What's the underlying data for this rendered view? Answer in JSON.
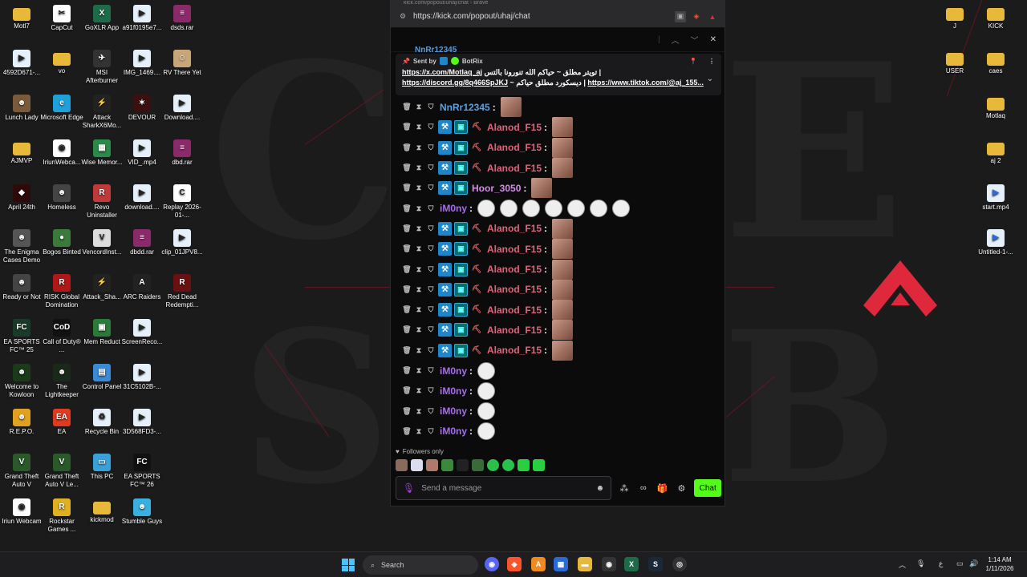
{
  "colors": {
    "kick_green": "#53fc18",
    "mod_badge": "#1f86c9",
    "alanod_name": "#e0637a",
    "nnrr_name": "#5aa0e6",
    "hoor_name": "#d58be8",
    "im0ny_name": "#a86cf0",
    "apex_red": "#e0283c"
  },
  "desktop_left": [
    {
      "label": "Motl7",
      "icon": "folder-icon",
      "color": "#e8b83a",
      "glyph": ""
    },
    {
      "label": "CapCut",
      "icon": "capcut-icon",
      "color": "#ffffff",
      "glyph": "✂"
    },
    {
      "label": "GoXLR App",
      "icon": "goxlr-icon",
      "color": "#1e6b4a",
      "glyph": "X"
    },
    {
      "label": "a91f0195e7...",
      "icon": "file-icon",
      "color": "#e6f0fa",
      "glyph": "▶"
    },
    {
      "label": "dsds.rar",
      "icon": "rar-icon",
      "color": "#8a2a6a",
      "glyph": "≡"
    },
    {
      "label": "4592D671-...",
      "icon": "file-icon",
      "color": "#e6f0fa",
      "glyph": "▶"
    },
    {
      "label": "vo",
      "icon": "folder-icon",
      "color": "#e8b83a",
      "glyph": ""
    },
    {
      "label": "MSI Afterburner",
      "icon": "msi-icon",
      "color": "#333333",
      "glyph": "✈"
    },
    {
      "label": "IMG_1469....",
      "icon": "file-icon",
      "color": "#e6f0fa",
      "glyph": "▶"
    },
    {
      "label": "RV There Yet",
      "icon": "game-icon",
      "color": "#c8a67a",
      "glyph": "☺"
    },
    {
      "label": "Lunch Lady",
      "icon": "game-icon",
      "color": "#7a5a3a",
      "glyph": "☻"
    },
    {
      "label": "Microsoft Edge",
      "icon": "edge-icon",
      "color": "#1fa0d8",
      "glyph": "e"
    },
    {
      "label": "Attack SharkX6Mo...",
      "icon": "mouse-icon",
      "color": "#222222",
      "glyph": "⚡"
    },
    {
      "label": "DEVOUR",
      "icon": "game-icon",
      "color": "#3a1010",
      "glyph": "✶"
    },
    {
      "label": "Download....",
      "icon": "file-icon",
      "color": "#e6f0fa",
      "glyph": "▶"
    },
    {
      "label": "AJMVP",
      "icon": "folder-icon",
      "color": "#e8b83a",
      "glyph": ""
    },
    {
      "label": "IriunWebca...",
      "icon": "webcam-icon",
      "color": "#ffffff",
      "glyph": "◉"
    },
    {
      "label": "Wise Memor...",
      "icon": "app-icon",
      "color": "#2a8a4a",
      "glyph": "▦"
    },
    {
      "label": "VID_.mp4",
      "icon": "file-icon",
      "color": "#e6f0fa",
      "glyph": "▶"
    },
    {
      "label": "dbd.rar",
      "icon": "rar-icon",
      "color": "#8a2a6a",
      "glyph": "≡"
    },
    {
      "label": "April 24th",
      "icon": "game-icon",
      "color": "#300a0a",
      "glyph": "◆"
    },
    {
      "label": "Homeless",
      "icon": "game-icon",
      "color": "#444444",
      "glyph": "☻"
    },
    {
      "label": "Revo Uninstaller",
      "icon": "app-icon",
      "color": "#c03a3a",
      "glyph": "R"
    },
    {
      "label": "download....",
      "icon": "file-icon",
      "color": "#e6f0fa",
      "glyph": "▶"
    },
    {
      "label": "Replay 2026-01-...",
      "icon": "capcut-icon",
      "color": "#ffffff",
      "glyph": "C"
    },
    {
      "label": "The Enigma Cases Demo",
      "icon": "game-icon",
      "color": "#555555",
      "glyph": "☻"
    },
    {
      "label": "Bogos Binted",
      "icon": "game-icon",
      "color": "#3a7a3a",
      "glyph": "●"
    },
    {
      "label": "VencordInst...",
      "icon": "app-icon",
      "color": "#dddddd",
      "glyph": "V"
    },
    {
      "label": "dbdd.rar",
      "icon": "rar-icon",
      "color": "#8a2a6a",
      "glyph": "≡"
    },
    {
      "label": "clip_01JPV8...",
      "icon": "file-icon",
      "color": "#e6f0fa",
      "glyph": "▶"
    },
    {
      "label": "Ready or Not",
      "icon": "game-icon",
      "color": "#444444",
      "glyph": "☻"
    },
    {
      "label": "RISK Global Domination",
      "icon": "game-icon",
      "color": "#b01818",
      "glyph": "R"
    },
    {
      "label": "Attack_Sha...",
      "icon": "mouse-icon",
      "color": "#222222",
      "glyph": "⚡"
    },
    {
      "label": "ARC Raiders",
      "icon": "game-icon",
      "color": "#222222",
      "glyph": "A"
    },
    {
      "label": "Red Dead Redempti...",
      "icon": "game-icon",
      "color": "#6a1010",
      "glyph": "R"
    },
    {
      "label": "EA SPORTS FC™ 25",
      "icon": "game-icon",
      "color": "#1a3a2a",
      "glyph": "FC"
    },
    {
      "label": "Call of Duty® ...",
      "icon": "game-icon",
      "color": "#111111",
      "glyph": "CoD"
    },
    {
      "label": "Mem Reduct",
      "icon": "app-icon",
      "color": "#2a7a3a",
      "glyph": "▣"
    },
    {
      "label": "ScreenReco...",
      "icon": "file-icon",
      "color": "#e6f0fa",
      "glyph": "▶"
    },
    {
      "label": "",
      "icon": "blank",
      "color": "transparent",
      "glyph": ""
    },
    {
      "label": "Welcome to Kowloon",
      "icon": "game-icon",
      "color": "#1a3a1a",
      "glyph": "☻"
    },
    {
      "label": "The Lightkeeper",
      "icon": "game-icon",
      "color": "#1a2a1a",
      "glyph": "☻"
    },
    {
      "label": "Control Panel",
      "icon": "control-panel-icon",
      "color": "#3a8ad8",
      "glyph": "▤"
    },
    {
      "label": "31C5102B-...",
      "icon": "file-icon",
      "color": "#e6f0fa",
      "glyph": "▶"
    },
    {
      "label": "",
      "icon": "blank",
      "color": "transparent",
      "glyph": ""
    },
    {
      "label": "R.E.P.O.",
      "icon": "game-icon",
      "color": "#e0a020",
      "glyph": "☻"
    },
    {
      "label": "EA",
      "icon": "ea-icon",
      "color": "#e03a20",
      "glyph": "EA"
    },
    {
      "label": "Recycle Bin",
      "icon": "recycle-bin-icon",
      "color": "#e6f0fa",
      "glyph": "♻"
    },
    {
      "label": "3D568FD3-...",
      "icon": "file-icon",
      "color": "#e6f0fa",
      "glyph": "▶"
    },
    {
      "label": "",
      "icon": "blank",
      "color": "transparent",
      "glyph": ""
    },
    {
      "label": "Grand Theft Auto V",
      "icon": "game-icon",
      "color": "#2a5a2a",
      "glyph": "V"
    },
    {
      "label": "Grand Theft Auto V Le...",
      "icon": "game-icon",
      "color": "#2a5a2a",
      "glyph": "V"
    },
    {
      "label": "This PC",
      "icon": "this-pc-icon",
      "color": "#3aa0d8",
      "glyph": "▭"
    },
    {
      "label": "EA SPORTS FC™ 26",
      "icon": "game-icon",
      "color": "#111111",
      "glyph": "FC"
    },
    {
      "label": "",
      "icon": "blank",
      "color": "transparent",
      "glyph": ""
    },
    {
      "label": "Iriun Webcam",
      "icon": "webcam-icon",
      "color": "#ffffff",
      "glyph": "◉"
    },
    {
      "label": "Rockstar Games ...",
      "icon": "game-icon",
      "color": "#e0b020",
      "glyph": "R"
    },
    {
      "label": "kickmod",
      "icon": "folder-icon",
      "color": "#e8b83a",
      "glyph": ""
    },
    {
      "label": "Stumble Guys",
      "icon": "game-icon",
      "color": "#3ab0e0",
      "glyph": "☻"
    }
  ],
  "desktop_right": [
    {
      "label": "J",
      "icon": "folder-icon"
    },
    {
      "label": "KICK",
      "icon": "folder-icon"
    },
    {
      "label": "USER",
      "icon": "folder-icon"
    },
    {
      "label": "caes",
      "icon": "folder-icon"
    },
    {
      "label": "Motlaq",
      "icon": "folder-icon"
    },
    {
      "label": "aj 2",
      "icon": "folder-icon"
    },
    {
      "label": "start.mp4",
      "icon": "file-icon"
    },
    {
      "label": "Untitled-1-...",
      "icon": "file-icon"
    }
  ],
  "browser": {
    "title": "kick.com/popout/uhaj/chat - Brave",
    "url": "https://kick.com/popout/uhaj/chat",
    "cut_message": "NnRr12345"
  },
  "pinned": {
    "sent_by_prefix": "Sent by",
    "sender": "BotRix",
    "line1_link": "https://x.com/Motlaq_aj",
    "line1_text": "تويتر مطلق ~ حياكم الله تنورونا بالتس |",
    "line2_link": "https://discord.gg/8q466SpJKJ",
    "line2_text": "~ ديسكورد مطلق حياكم |",
    "line2_link2": "https://www.tiktok.com/@aj_155..."
  },
  "messages": [
    {
      "user": "NnRr12345",
      "color": "#5aa0e6",
      "badges": [],
      "emote": "img"
    },
    {
      "user": "Alanod_F15",
      "color": "#e0637a",
      "badges": [
        "mod",
        "sub",
        "pick"
      ],
      "emote": "img"
    },
    {
      "user": "Alanod_F15",
      "color": "#e0637a",
      "badges": [
        "mod",
        "sub",
        "pick"
      ],
      "emote": "img"
    },
    {
      "user": "Alanod_F15",
      "color": "#e0637a",
      "badges": [
        "mod",
        "sub",
        "pick"
      ],
      "emote": "img"
    },
    {
      "user": "Hoor_3050",
      "color": "#d58be8",
      "badges": [
        "mod",
        "sub"
      ],
      "emote": "img"
    },
    {
      "user": "iM0ny",
      "color": "#a86cf0",
      "badges": [],
      "emote": "round7"
    },
    {
      "user": "Alanod_F15",
      "color": "#e0637a",
      "badges": [
        "mod",
        "sub",
        "pick"
      ],
      "emote": "img"
    },
    {
      "user": "Alanod_F15",
      "color": "#e0637a",
      "badges": [
        "mod",
        "sub",
        "pick"
      ],
      "emote": "img"
    },
    {
      "user": "Alanod_F15",
      "color": "#e0637a",
      "badges": [
        "mod",
        "sub",
        "pick"
      ],
      "emote": "img"
    },
    {
      "user": "Alanod_F15",
      "color": "#e0637a",
      "badges": [
        "mod",
        "sub",
        "pick"
      ],
      "emote": "img"
    },
    {
      "user": "Alanod_F15",
      "color": "#e0637a",
      "badges": [
        "mod",
        "sub",
        "pick"
      ],
      "emote": "img"
    },
    {
      "user": "Alanod_F15",
      "color": "#e0637a",
      "badges": [
        "mod",
        "sub",
        "pick"
      ],
      "emote": "img"
    },
    {
      "user": "Alanod_F15",
      "color": "#e0637a",
      "badges": [
        "mod",
        "sub",
        "pick"
      ],
      "emote": "img"
    },
    {
      "user": "iM0ny",
      "color": "#a86cf0",
      "badges": [],
      "emote": "round1"
    },
    {
      "user": "iM0ny",
      "color": "#a86cf0",
      "badges": [],
      "emote": "round1"
    },
    {
      "user": "iM0ny",
      "color": "#a86cf0",
      "badges": [],
      "emote": "round1"
    },
    {
      "user": "iM0ny",
      "color": "#a86cf0",
      "badges": [],
      "emote": "round1"
    }
  ],
  "chat_footer": {
    "followers_only": "Followers only",
    "placeholder": "Send a message",
    "chat_button": "Chat"
  },
  "taskbar": {
    "search_label": "Search",
    "language": "ع",
    "time": "1:14 AM",
    "date": "1/11/2026"
  }
}
